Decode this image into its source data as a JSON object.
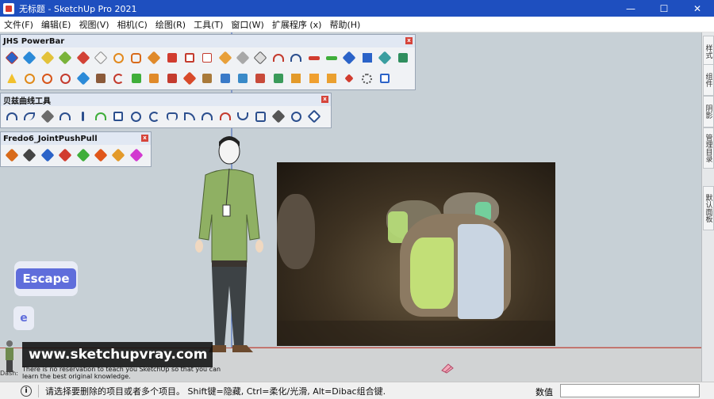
{
  "window": {
    "title": "无标题 - SketchUp Pro 2021",
    "min_glyph": "—",
    "max_glyph": "☐",
    "close_glyph": "✕"
  },
  "menu": [
    "文件(F)",
    "编辑(E)",
    "视图(V)",
    "相机(C)",
    "绘图(R)",
    "工具(T)",
    "窗口(W)",
    "扩展程序 (x)",
    "帮助(H)"
  ],
  "toolbars": {
    "powerbar": {
      "title": "JHS PowerBar",
      "close": "x"
    },
    "bezier": {
      "title": "贝兹曲线工具",
      "close": "x"
    },
    "fredo": {
      "title": "Fredo6_JointPushPull",
      "close": "x"
    }
  },
  "right_tray": [
    "样式",
    "组件",
    "阴影",
    "管理目录",
    "默认面板"
  ],
  "overlay": {
    "escape_key": "Escape",
    "e_key": "e",
    "watermark": "www.sketchupvray.com",
    "caption": "There is no reservation to teach you SketchUp so that you can learn the best original knowledge.",
    "caption_left": "Dash:"
  },
  "status": {
    "message": "请选择要删除的项目或者多个项目。 Shift键=隐藏, Ctrl=柔化/光滑, Alt=Dibac组合键.",
    "value_label": "数值",
    "value_input": ""
  },
  "colors": {
    "titlebar": "#1e4fbf",
    "photo_glow": "#b8e07a",
    "accent_red": "#d6453b"
  }
}
